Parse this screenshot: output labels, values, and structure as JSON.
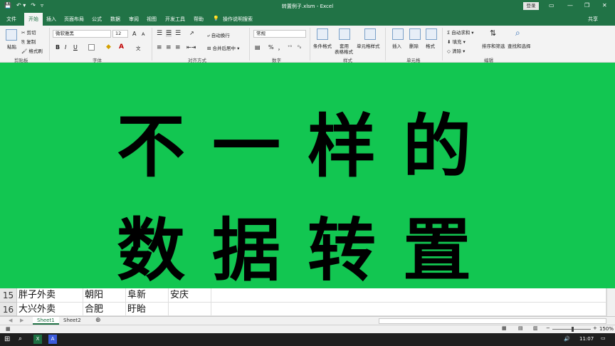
{
  "titlebar": {
    "title": "转置例子.xlsm  -  Excel",
    "login": "登录",
    "qat": [
      "💾",
      "↶ ▾",
      "↷",
      "▿"
    ],
    "win_controls": [
      "▭",
      "—",
      "❐",
      "✕"
    ]
  },
  "tabs": {
    "file": "文件",
    "home": "开始",
    "insert": "插入",
    "layout": "页面布局",
    "formulas": "公式",
    "data": "数据",
    "review": "审阅",
    "view": "视图",
    "developer": "开发工具",
    "help": "帮助",
    "tell_me": "操作说明搜索",
    "share": "共享"
  },
  "ribbon": {
    "clipboard": {
      "paste": "粘贴",
      "cut": "剪切",
      "copy": "复制",
      "format_painter": "格式刷",
      "label": "剪贴板"
    },
    "font": {
      "name": "微软雅黑",
      "size": "12",
      "grow": "A",
      "shrink": "A",
      "bold": "B",
      "italic": "I",
      "underline": "U",
      "wen": "文",
      "label": "字体"
    },
    "alignment": {
      "wrap": "自动换行",
      "merge": "合并后居中",
      "label": "对齐方式"
    },
    "number": {
      "format": "常规",
      "percent": "%",
      "comma": "，",
      "label": "数字"
    },
    "styles": {
      "conditional": "条件格式",
      "table_format": "套用",
      "table_format2": "表格格式",
      "cell_style": "单元格样式",
      "label": "样式"
    },
    "cells": {
      "insert": "插入",
      "delete": "删除",
      "format": "格式",
      "label": "单元格"
    },
    "editing": {
      "autosum": "自动求和",
      "fill": "填充",
      "clear": "清除",
      "sort": "排序和筛选",
      "find": "查找和选择",
      "label": "编辑"
    }
  },
  "overlay": {
    "line1": "不一样的",
    "line2": "数据转置"
  },
  "sheet": {
    "rows": [
      {
        "num": "15",
        "cells": [
          "胖子外卖",
          "朝阳",
          "阜新",
          "安庆"
        ]
      },
      {
        "num": "16",
        "cells": [
          "大兴外卖",
          "合肥",
          "盱眙",
          ""
        ]
      }
    ],
    "tabs": [
      "Sheet1",
      "Sheet2"
    ],
    "add": "⊕"
  },
  "status": {
    "zoom": "150%",
    "minus": "−",
    "plus": "+"
  },
  "taskbar": {
    "time": "11:07"
  },
  "colors": {
    "excel_green": "#217346",
    "overlay_green": "#12c651"
  }
}
